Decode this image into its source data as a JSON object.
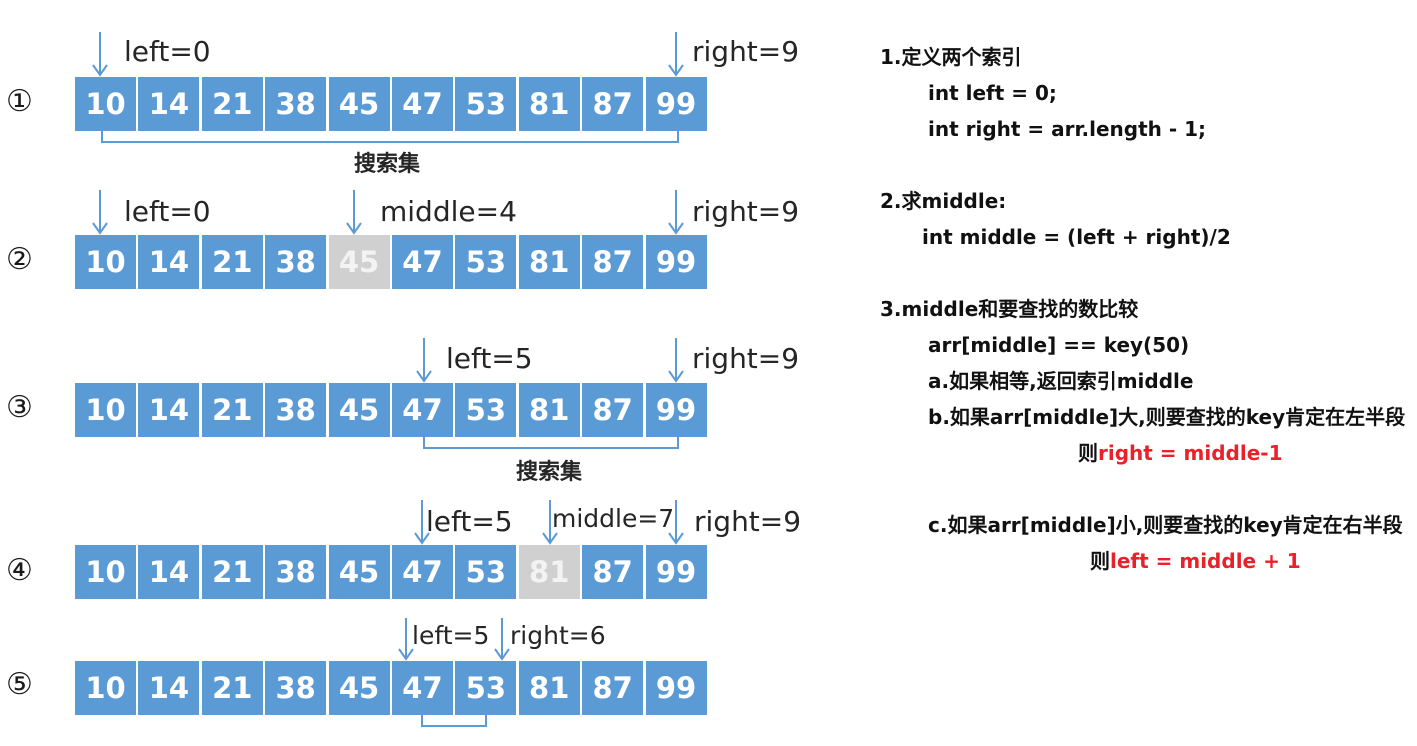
{
  "steps": [
    {
      "label": "①",
      "values": [
        "10",
        "14",
        "21",
        "38",
        "45",
        "47",
        "53",
        "81",
        "87",
        "99"
      ],
      "pointers": [
        "left=0",
        "right=9"
      ],
      "range_label": "搜索集"
    },
    {
      "label": "②",
      "values": [
        "10",
        "14",
        "21",
        "38",
        "45",
        "47",
        "53",
        "81",
        "87",
        "99"
      ],
      "pointers": [
        "left=0",
        "middle=4",
        "right=9"
      ],
      "highlight_index": 4
    },
    {
      "label": "③",
      "values": [
        "10",
        "14",
        "21",
        "38",
        "45",
        "47",
        "53",
        "81",
        "87",
        "99"
      ],
      "pointers": [
        "left=5",
        "right=9"
      ],
      "range_label": "搜索集"
    },
    {
      "label": "④",
      "values": [
        "10",
        "14",
        "21",
        "38",
        "45",
        "47",
        "53",
        "81",
        "87",
        "99"
      ],
      "pointers": [
        "left=5",
        "middle=7",
        "right=9"
      ],
      "highlight_index": 7
    },
    {
      "label": "⑤",
      "values": [
        "10",
        "14",
        "21",
        "38",
        "45",
        "47",
        "53",
        "81",
        "87",
        "99"
      ],
      "pointers": [
        "left=5",
        "right=6"
      ]
    }
  ],
  "notes": {
    "n1_title": "1.定义两个索引",
    "n1_line1": "int left = 0;",
    "n1_line2": "int right = arr.length - 1;",
    "n2_title": "2.求middle:",
    "n2_line1": "int middle = (left + right)/2",
    "n3_title": "3.middle和要查找的数比较",
    "n3_line1": "arr[middle]  == key(50)",
    "n3_a": "a.如果相等,返回索引middle",
    "n3_b": "b.如果arr[middle]大,则要查找的key肯定在左半段",
    "n3_b_prefix": "则",
    "n3_b_red": "right = middle-1",
    "n3_c": "c.如果arr[middle]小,则要查找的key肯定在右半段",
    "n3_c_prefix": "则",
    "n3_c_red": "left = middle + 1"
  },
  "colors": {
    "cell": "#5b9bd5",
    "highlight": "#d0d0d0",
    "arrow": "#5b9bd5",
    "accent_red": "#e8222a"
  }
}
